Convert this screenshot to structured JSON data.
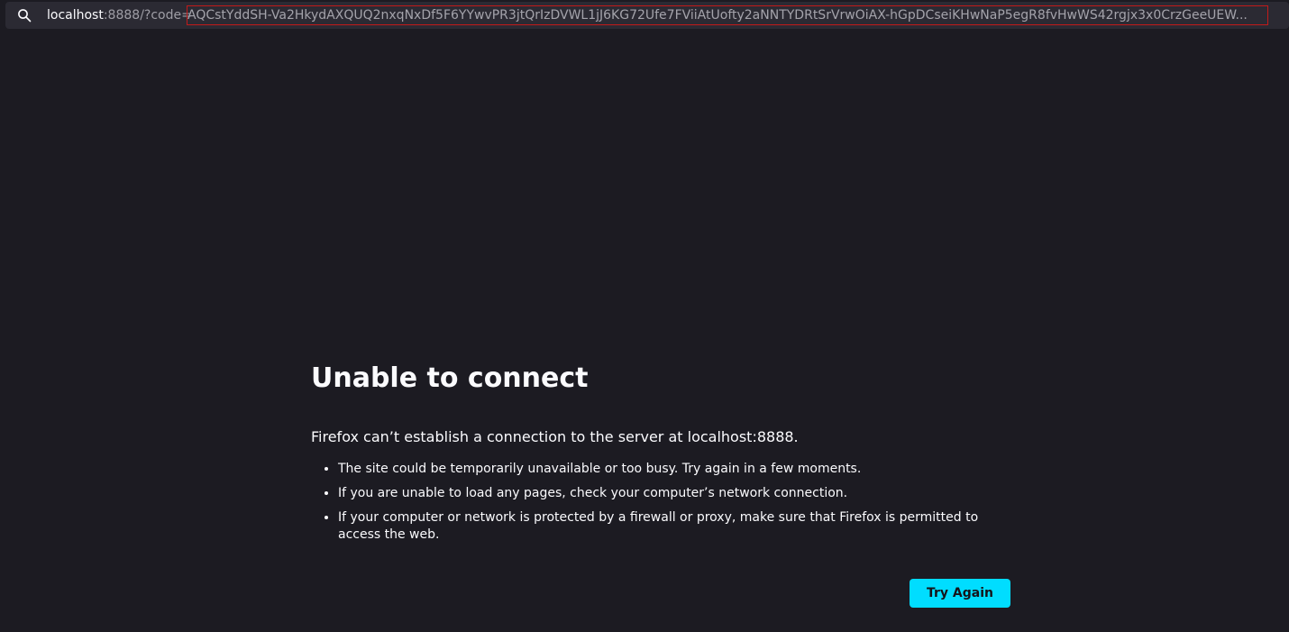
{
  "urlbar": {
    "icon": "search-icon",
    "host": "localhost",
    "rest": ":8888/?code=",
    "code": "AQCstYddSH-Va2HkydAXQUQ2nxqNxDf5F6YYwvPR3jtQrIzDVWL1jJ6KG72Ufe7FViiAtUofty2aNNTYDRtSrVrwOiAX-hGpDCseiKHwNaP5egR8fvHwWS42rgjx3x0CrzGeeUEW..."
  },
  "error": {
    "title": "Unable to connect",
    "intro": "Firefox can’t establish a connection to the server at localhost:8888.",
    "reasons": [
      "The site could be temporarily unavailable or too busy. Try again in a few moments.",
      "If you are unable to load any pages, check your computer’s network connection.",
      "If your computer or network is protected by a firewall or proxy, make sure that Firefox is permitted to access the web."
    ],
    "button_label": "Try Again"
  },
  "colors": {
    "background": "#1c1b22",
    "urlbar": "#2b2a33",
    "accent_button": "#00ddff",
    "highlight_border": "#c21a1a"
  }
}
